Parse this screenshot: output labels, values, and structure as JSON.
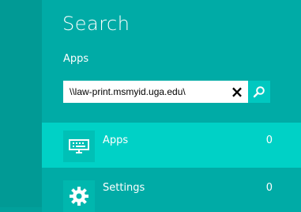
{
  "charm": {
    "title": "Search",
    "scope": "Apps"
  },
  "search": {
    "value": "\\\\law-print.msmyid.uga.edu\\",
    "clear_icon": "×",
    "search_icon": "search-icon"
  },
  "results": [
    {
      "label": "Apps",
      "count": "0",
      "icon": "keyboard-icon"
    },
    {
      "label": "Settings",
      "count": "0",
      "icon": "gear-icon"
    }
  ],
  "colors": {
    "background": "#00aba6",
    "left_strip": "#019a95",
    "selected_result": "#00d1c6",
    "search_button": "#00c8c0"
  }
}
